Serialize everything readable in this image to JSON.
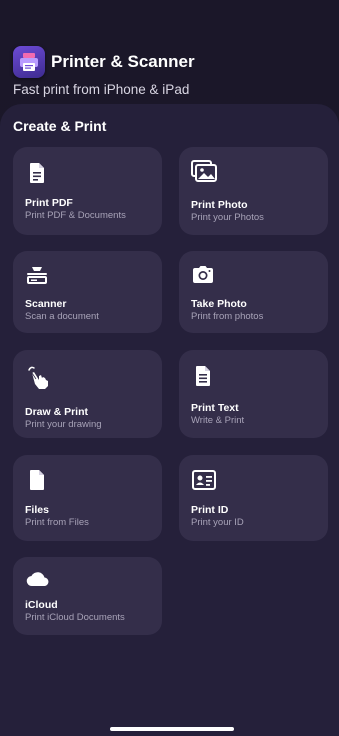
{
  "header": {
    "title": "Printer & Scanner",
    "subtitle": "Fast print from iPhone & iPad",
    "logo_icon": "printer-app-icon"
  },
  "section": {
    "title": "Create & Print"
  },
  "cards": [
    {
      "label": "Print PDF",
      "sub": "Print PDF & Documents",
      "icon": "document-icon"
    },
    {
      "label": "Print Photo",
      "sub": "Print your Photos",
      "icon": "photos-icon"
    },
    {
      "label": "Scanner",
      "sub": "Scan a document",
      "icon": "scanner-icon"
    },
    {
      "label": "Take Photo",
      "sub": "Print from photos",
      "icon": "camera-icon"
    },
    {
      "label": "Draw & Print",
      "sub": "Print your drawing",
      "icon": "hand-draw-icon"
    },
    {
      "label": "Print Text",
      "sub": "Write & Print",
      "icon": "text-document-icon"
    },
    {
      "label": "Files",
      "sub": "Print from Files",
      "icon": "file-icon"
    },
    {
      "label": "Print ID",
      "sub": "Print your ID",
      "icon": "id-card-icon"
    },
    {
      "label": "iCloud",
      "sub": "Print iCloud Documents",
      "icon": "cloud-icon"
    }
  ],
  "colors": {
    "background": "#1a1628",
    "panel": "#25203a",
    "card": "#342e4a",
    "accent": "#6d4bd6",
    "subtext": "#a8a3b8"
  }
}
